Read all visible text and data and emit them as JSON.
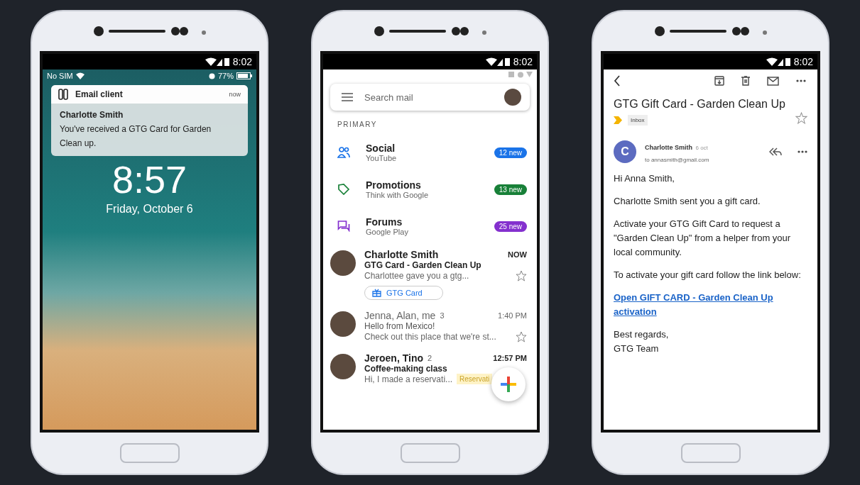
{
  "lock_screen": {
    "status_time": "8:02",
    "carrier": "No SIM",
    "battery": "77%",
    "notification": {
      "app": "Email client",
      "time": "now",
      "sender": "Charlotte Smith",
      "text": "You've received a GTG Card for Garden Clean up."
    },
    "clock": "8:57",
    "date": "Friday, October 6"
  },
  "inbox": {
    "status_time": "8:02",
    "search": {
      "placeholder": "Search mail"
    },
    "section": "PRIMARY",
    "categories": [
      {
        "kind": "social",
        "name": "Social",
        "source": "YouTube",
        "badge": "12 new",
        "color": "#1a73e8"
      },
      {
        "kind": "promotions",
        "name": "Promotions",
        "source": "Think with Google",
        "badge": "13 new",
        "color": "#188038"
      },
      {
        "kind": "forums",
        "name": "Forums",
        "source": "Google Play",
        "badge": "25 new",
        "color": "#8430ce"
      }
    ],
    "emails": [
      {
        "sender": "Charlotte Smith",
        "time": "NOW",
        "subject": "GTG Card - Garden Clean Up",
        "snippet": "Charlottee gave you a gtg...",
        "unread": true,
        "starred": false,
        "chip": "GTG Card"
      },
      {
        "sender": "Jenna, Alan, me",
        "count": "3",
        "time": "1:40 PM",
        "subject": "Hello from Mexico!",
        "snippet": "Check out this place that we're st...",
        "unread": false,
        "starred": false
      },
      {
        "sender": "Jeroen, Tino",
        "count": "2",
        "time": "12:57 PM",
        "subject": "Coffee-making class",
        "snippet": "Hi, I made a reservati...",
        "unread": true,
        "tag": "Reservati"
      }
    ]
  },
  "message": {
    "status_time": "8:02",
    "subject": "GTG Gift Card - Garden Clean Up",
    "label": "Inbox",
    "starred": false,
    "avatar_letter": "C",
    "sender": "Charlotte Smith",
    "date": "6 oct",
    "to": "to annasmith@gmail.com",
    "body": [
      {
        "kind": "text",
        "text": "Hi Anna Smith,"
      },
      {
        "kind": "text",
        "text": "Charlotte Smith sent you a gift card."
      },
      {
        "kind": "text",
        "text": "Activate your GTG Gift Card to request a \"Garden Clean Up\" from a helper from your local community."
      },
      {
        "kind": "text",
        "text": "To activate your gift card follow the link below:"
      },
      {
        "kind": "link",
        "text": "Open GIFT CARD - Garden Clean Up activation"
      },
      {
        "kind": "closing",
        "lines": [
          "Best regards,",
          "GTG Team"
        ]
      }
    ]
  }
}
